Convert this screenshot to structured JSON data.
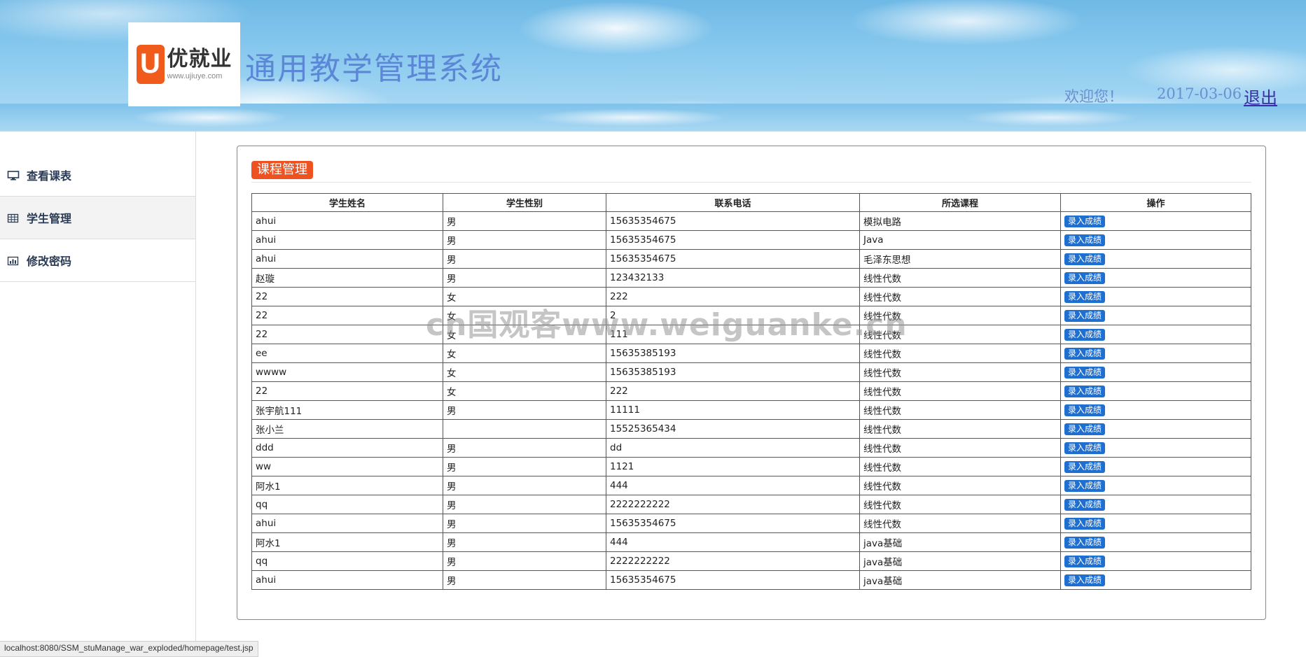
{
  "header": {
    "logo": {
      "brand": "优就业",
      "url": "www.ujiuye.com",
      "mark": "U"
    },
    "app_title": "通用教学管理系统",
    "welcome": "欢迎您！",
    "date": "2017-03-06",
    "logout": "退出"
  },
  "sidebar": {
    "items": [
      {
        "label": "查看课表",
        "icon": "monitor-icon"
      },
      {
        "label": "学生管理",
        "icon": "grid-icon"
      },
      {
        "label": "修改密码",
        "icon": "bar-chart-icon"
      }
    ]
  },
  "panel": {
    "title": "课程管理",
    "columns": [
      "学生姓名",
      "学生性别",
      "联系电话",
      "所选课程",
      "操作"
    ],
    "action_label": "录入成绩",
    "rows": [
      [
        "ahui",
        "男",
        "15635354675",
        "模拟电路"
      ],
      [
        "ahui",
        "男",
        "15635354675",
        "Java"
      ],
      [
        "ahui",
        "男",
        "15635354675",
        "毛泽东思想"
      ],
      [
        "赵璇",
        "男",
        "123432133",
        "线性代数"
      ],
      [
        "22",
        "女",
        "222",
        "线性代数"
      ],
      [
        "22",
        "女",
        "2",
        "线性代数"
      ],
      [
        "22",
        "女",
        "111",
        "线性代数"
      ],
      [
        "ee",
        "女",
        "15635385193",
        "线性代数"
      ],
      [
        "wwww",
        "女",
        "15635385193",
        "线性代数"
      ],
      [
        "22",
        "女",
        "222",
        "线性代数"
      ],
      [
        "张宇航111",
        "男",
        "11111",
        "线性代数"
      ],
      [
        "张小兰",
        "",
        "15525365434",
        "线性代数"
      ],
      [
        "ddd",
        "男",
        "dd",
        "线性代数"
      ],
      [
        "ww",
        "男",
        "1121",
        "线性代数"
      ],
      [
        "阿水1",
        "男",
        "444",
        "线性代数"
      ],
      [
        "qq",
        "男",
        "2222222222",
        "线性代数"
      ],
      [
        "ahui",
        "男",
        "15635354675",
        "线性代数"
      ],
      [
        "阿水1",
        "男",
        "444",
        "java基础"
      ],
      [
        "qq",
        "男",
        "2222222222",
        "java基础"
      ],
      [
        "ahui",
        "男",
        "15635354675",
        "java基础"
      ]
    ]
  },
  "watermark": "cn国观客www.weiguanke.cn",
  "statusbar": {
    "url": "localhost:8080/SSM_stuManage_war_exploded/homepage/test.jsp"
  },
  "colors": {
    "title_badge": "#ee5220",
    "action_button": "#1e6fd0",
    "app_title": "#5b87d6",
    "logo_mark": "#f05a1a"
  }
}
